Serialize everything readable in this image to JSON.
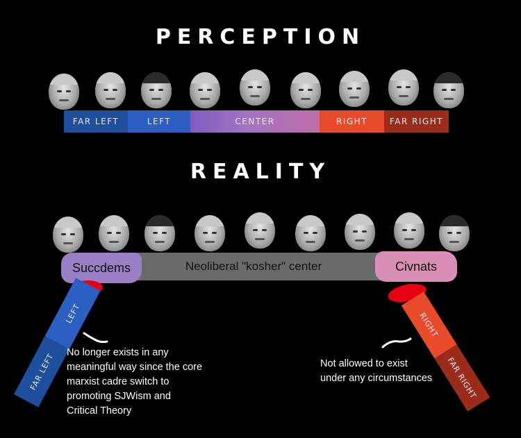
{
  "perception": {
    "title": "PERCEPTION",
    "segments": [
      {
        "label": "FAR LEFT",
        "color": "#1f4e9c"
      },
      {
        "label": "LEFT",
        "color": "#2d5fc2"
      },
      {
        "label": "CENTER",
        "color": "#9a6fc0"
      },
      {
        "label": "RIGHT",
        "color": "#e84a2c"
      },
      {
        "label": "FAR RIGHT",
        "color": "#9b2b1a"
      }
    ]
  },
  "reality": {
    "title": "REALITY",
    "left_label": "Succdems",
    "center_label": "Neoliberal \"kosher\" center",
    "right_label": "Civnats",
    "left_color": "#9b7fc4",
    "right_color": "#d98fb5",
    "bar_color": "#6a6a6a",
    "left_bar": {
      "far_left": "FAR LEFT",
      "left": "LEFT"
    },
    "right_bar": {
      "right": "RIGHT",
      "far_right": "FAR RIGHT"
    }
  },
  "notes": {
    "left": [
      "No longer exists in any",
      "meaningful way since the core",
      "marxist cadre switch to",
      "promoting SJWism and",
      "Critical Theory"
    ],
    "right": [
      "Not allowed to exist",
      "under any circumstances"
    ]
  }
}
